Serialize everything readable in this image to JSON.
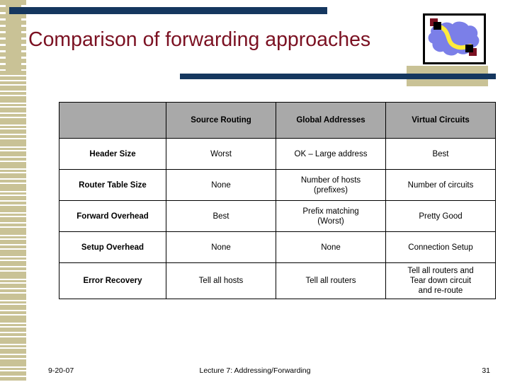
{
  "slide": {
    "title": "Comparison of forwarding approaches",
    "title_color": "#7b1122",
    "accent_bar_color": "#15375f",
    "band_color": "#c9c296",
    "header_fill": "#a9a9a9"
  },
  "logo": {
    "name": "network-cloud-logo",
    "cloud_color": "#7b7fe8",
    "path_color": "#ffeb3b",
    "node_color": "#000000",
    "node_accent_color": "#7b1122",
    "border_color": "#000000"
  },
  "table": {
    "corner_label": "",
    "columns": [
      "Source Routing",
      "Global Addresses",
      "Virtual Circuits"
    ],
    "rows": [
      {
        "label": "Header Size",
        "cells": [
          "Worst",
          "OK – Large address",
          "Best"
        ]
      },
      {
        "label": "Router Table Size",
        "cells": [
          "None",
          "Number of hosts\n(prefixes)",
          "Number of circuits"
        ]
      },
      {
        "label": "Forward Overhead",
        "cells": [
          "Best",
          "Prefix matching\n(Worst)",
          "Pretty Good"
        ]
      },
      {
        "label": "Setup Overhead",
        "cells": [
          "None",
          "None",
          "Connection Setup"
        ]
      },
      {
        "label": "Error Recovery",
        "cells": [
          "Tell all hosts",
          "Tell all routers",
          "Tell all routers and\nTear down circuit\nand re-route"
        ]
      }
    ]
  },
  "footer": {
    "date": "9-20-07",
    "center": "Lecture 7: Addressing/Forwarding",
    "page": "31"
  }
}
